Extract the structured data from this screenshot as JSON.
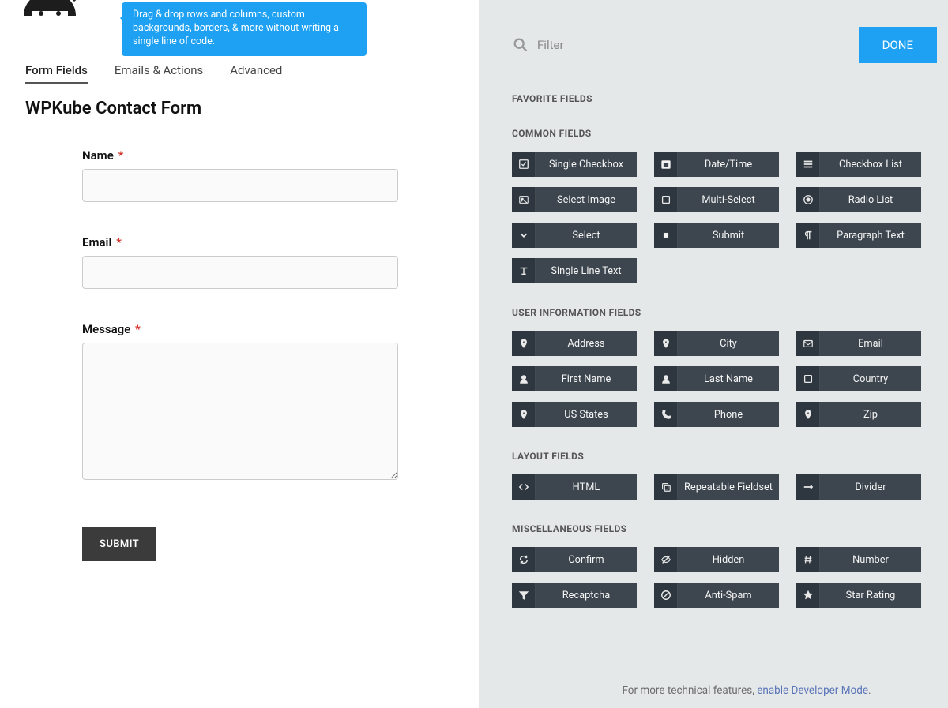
{
  "tooltip": "Drag & drop rows and columns, custom backgrounds, borders, & more without writing a single line of code.",
  "tabs": {
    "form_fields": "Form Fields",
    "emails_actions": "Emails & Actions",
    "advanced": "Advanced"
  },
  "form_title": "WPKube Contact Form",
  "fields": {
    "name_label": "Name",
    "email_label": "Email",
    "message_label": "Message",
    "submit_label": "SUBMIT"
  },
  "filter_placeholder": "Filter",
  "done_label": "DONE",
  "sections": {
    "favorite": "FAVORITE FIELDS",
    "common": "COMMON FIELDS",
    "user": "USER INFORMATION FIELDS",
    "layout": "LAYOUT FIELDS",
    "misc": "MISCELLANEOUS FIELDS"
  },
  "common_fields": [
    {
      "icon": "check-square",
      "label": "Single Checkbox"
    },
    {
      "icon": "calendar",
      "label": "Date/Time"
    },
    {
      "icon": "list",
      "label": "Checkbox List"
    },
    {
      "icon": "image",
      "label": "Select Image"
    },
    {
      "icon": "square",
      "label": "Multi-Select"
    },
    {
      "icon": "dot-circle",
      "label": "Radio List"
    },
    {
      "icon": "chevron-down",
      "label": "Select"
    },
    {
      "icon": "square-small",
      "label": "Submit"
    },
    {
      "icon": "paragraph",
      "label": "Paragraph Text"
    },
    {
      "icon": "text-line",
      "label": "Single Line Text"
    }
  ],
  "user_fields": [
    {
      "icon": "pin",
      "label": "Address"
    },
    {
      "icon": "pin",
      "label": "City"
    },
    {
      "icon": "mail",
      "label": "Email"
    },
    {
      "icon": "user",
      "label": "First Name"
    },
    {
      "icon": "user",
      "label": "Last Name"
    },
    {
      "icon": "square",
      "label": "Country"
    },
    {
      "icon": "pin",
      "label": "US States"
    },
    {
      "icon": "phone",
      "label": "Phone"
    },
    {
      "icon": "pin",
      "label": "Zip"
    }
  ],
  "layout_fields": [
    {
      "icon": "code",
      "label": "HTML"
    },
    {
      "icon": "copy",
      "label": "Repeatable Fieldset"
    },
    {
      "icon": "arrows",
      "label": "Divider"
    }
  ],
  "misc_fields": [
    {
      "icon": "refresh",
      "label": "Confirm"
    },
    {
      "icon": "eye-off",
      "label": "Hidden"
    },
    {
      "icon": "hash",
      "label": "Number"
    },
    {
      "icon": "filter",
      "label": "Recaptcha"
    },
    {
      "icon": "ban",
      "label": "Anti-Spam"
    },
    {
      "icon": "star",
      "label": "Star Rating"
    }
  ],
  "footer": {
    "pre": "For more technical features, ",
    "link": "enable Developer Mode",
    "post": "."
  }
}
